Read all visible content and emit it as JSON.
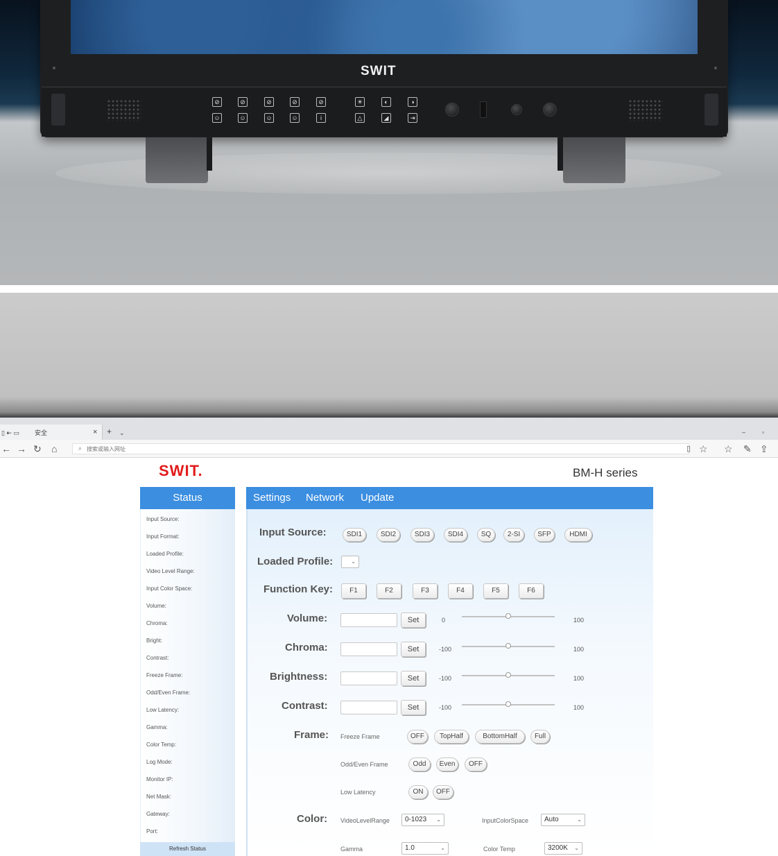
{
  "photo": {
    "brand": "SWIT",
    "screen_color": "#2c5c94",
    "panel_buttons": [
      "user-key",
      "user-key",
      "user-key",
      "user-key",
      "info-key"
    ]
  },
  "browser": {
    "tab_title": "安全",
    "close_glyph": "×",
    "new_tab_glyph": "+",
    "address_placeholder": "搜索或输入网址",
    "window_minimize": "–",
    "window_restore": "▫"
  },
  "header": {
    "brand": "SWIT.",
    "series": "BM-H series"
  },
  "status": {
    "tab_label": "Status",
    "items": [
      "Input Source:",
      "Input Format:",
      "Loaded Profile:",
      "Video Level Range:",
      "Input Color Space:",
      "Volume:",
      "Chroma:",
      "Bright:",
      "Contrast:",
      "Freeze Frame:",
      "Odd/Even Frame:",
      "Low Latency:",
      "Gamma:",
      "Color Temp:",
      "Log Mode:",
      "Monitor IP:",
      "Net Mask:",
      "Gateway:",
      "Port:"
    ],
    "refresh_label": "Refresh Status"
  },
  "tabs": [
    "Settings",
    "Network",
    "Update"
  ],
  "settings": {
    "input_source": {
      "label": "Input Source:",
      "options": [
        "SDI1",
        "SDI2",
        "SDI3",
        "SDI4",
        "SQ",
        "2-SI",
        "SFP",
        "HDMI"
      ]
    },
    "loaded_profile": {
      "label": "Loaded Profile:",
      "value": ""
    },
    "function_key": {
      "label": "Function Key:",
      "keys": [
        "F1",
        "F2",
        "F3",
        "F4",
        "F5",
        "F6"
      ]
    },
    "volume": {
      "label": "Volume:",
      "set": "Set",
      "min": "0",
      "max": "100",
      "level": 0.5
    },
    "chroma": {
      "label": "Chroma:",
      "set": "Set",
      "min": "-100",
      "max": "100",
      "level": 0.5
    },
    "brightness": {
      "label": "Brightness:",
      "set": "Set",
      "min": "-100",
      "max": "100",
      "level": 0.5
    },
    "contrast": {
      "label": "Contrast:",
      "set": "Set",
      "min": "-100",
      "max": "100",
      "level": 0.5
    },
    "frame": {
      "label": "Frame:",
      "freeze_label": "Freeze Frame",
      "freeze_options": [
        "OFF",
        "TopHalf",
        "BottomHalf",
        "Full"
      ],
      "oddeven_label": "Odd/Even Frame",
      "oddeven_options": [
        "Odd",
        "Even",
        "OFF"
      ],
      "latency_label": "Low Latency",
      "latency_options": [
        "ON",
        "OFF"
      ]
    },
    "color": {
      "label": "Color:",
      "video_level_label": "VideoLevelRange",
      "video_level_value": "0-1023",
      "input_color_label": "InputColorSpace",
      "input_color_value": "Auto",
      "gamma_label": "Gamma",
      "gamma_value": "1.0",
      "color_temp_label": "Color Temp",
      "color_temp_value": "3200K"
    }
  },
  "colors": {
    "accent": "#3b8ee0",
    "brand_red": "#e21b1b"
  }
}
